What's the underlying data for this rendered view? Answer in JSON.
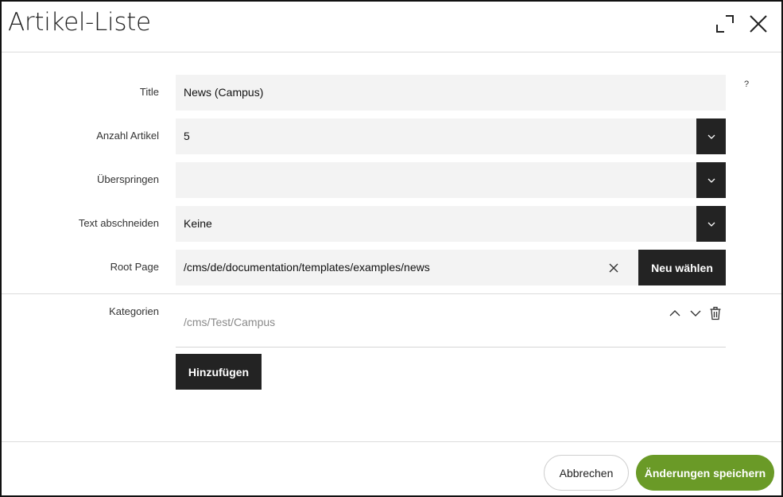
{
  "dialog": {
    "title": "Artikel-Liste",
    "icons": {
      "maximize": "expand-icon",
      "close": "close-icon"
    }
  },
  "form": {
    "help": "?",
    "title_label": "Title",
    "title_value": "News (Campus)",
    "count_label": "Anzahl Artikel",
    "count_value": "5",
    "skip_label": "Überspringen",
    "skip_value": "",
    "truncate_label": "Text abschneiden",
    "truncate_value": "Keine",
    "root_label": "Root Page",
    "root_value": "/cms/de/documentation/templates/examples/news",
    "root_button": "Neu wählen",
    "categories_label": "Kategorien",
    "categories": [
      {
        "path": "/cms/Test/Campus"
      }
    ],
    "add_button": "Hinzufügen"
  },
  "footer": {
    "cancel": "Abbrechen",
    "save": "Änderungen speichern"
  },
  "colors": {
    "dark": "#232323",
    "accent": "#6a9a27",
    "field_bg": "#f3f3f3"
  }
}
